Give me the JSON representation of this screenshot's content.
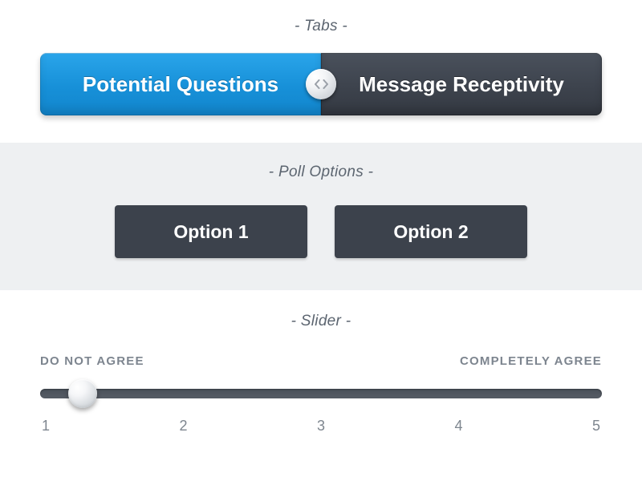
{
  "sections": {
    "tabs_label": "- Tabs -",
    "poll_label": "- Poll Options -",
    "slider_label": "- Slider -"
  },
  "tabs": {
    "left": "Potential Questions",
    "right": "Message Receptivity",
    "active": "left"
  },
  "poll": {
    "options": [
      "Option 1",
      "Option 2"
    ]
  },
  "slider": {
    "left_label": "DO NOT AGREE",
    "right_label": "COMPLETELY AGREE",
    "ticks": [
      "1",
      "2",
      "3",
      "4",
      "5"
    ],
    "min": 1,
    "max": 5,
    "value": 1.3
  },
  "colors": {
    "active_tab": "#1790d8",
    "inactive_tab": "#3d434d",
    "panel_bg": "#eef0f2",
    "button_bg": "#3c424c"
  }
}
